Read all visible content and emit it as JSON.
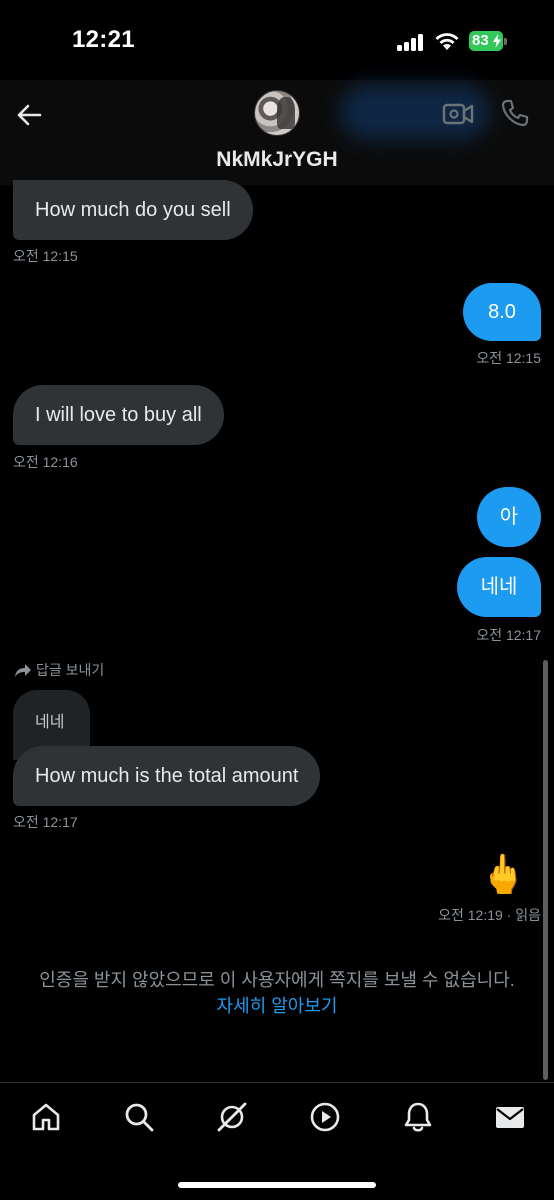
{
  "status_bar": {
    "time": "12:21",
    "battery": "83"
  },
  "header": {
    "username": "NkMkJrYGH"
  },
  "messages": [
    {
      "text": "How much do you sell",
      "time": "오전 12:15"
    },
    {
      "text": "8.0",
      "time": "오전 12:15"
    },
    {
      "text": "I will love to buy all",
      "time": "오전 12:16"
    },
    {
      "text": "아"
    },
    {
      "text": "네네",
      "time": "오전 12:17"
    },
    {
      "reply_label": "답글 보내기",
      "quoted": "네네",
      "text": "How much is the total amount",
      "time": "오전 12:17"
    },
    {
      "emoji": "🖕",
      "time": "오전 12:19",
      "read": "· 읽음"
    }
  ],
  "notice": {
    "text": "인증을 받지 않았으므로 이 사용자에게 쪽지를 보낼 수 없습니다.",
    "link": "자세히 알아보기"
  },
  "colors": {
    "background": "#000000",
    "bubble_incoming": "#2f3336",
    "bubble_outgoing": "#1d9bf0",
    "link": "#1d9bf0",
    "battery": "#34c759"
  },
  "bottom_nav": [
    "home-icon",
    "search-icon",
    "grok-icon",
    "video-play-icon",
    "notifications-bell-icon",
    "messages-envelope-icon"
  ]
}
